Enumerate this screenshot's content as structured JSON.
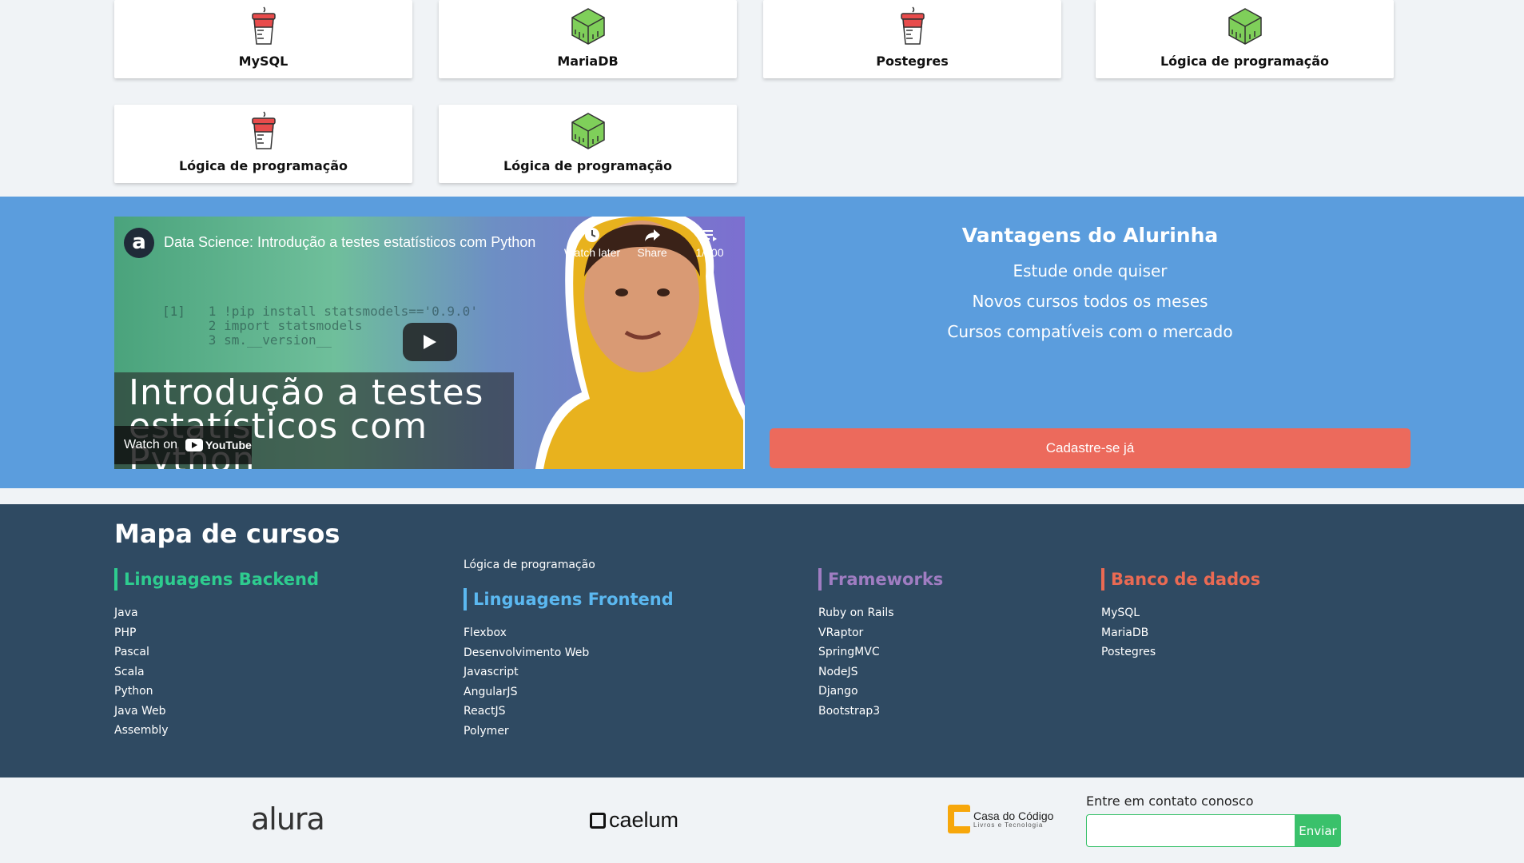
{
  "courses": [
    {
      "label": "MySQL",
      "icon": "database-cup-icon"
    },
    {
      "label": "MariaDB",
      "icon": "database-cube-icon"
    },
    {
      "label": "Postegres",
      "icon": "database-cup-icon"
    },
    {
      "label": "Lógica de programação",
      "icon": "database-cube-icon"
    },
    {
      "label": "Lógica de programação",
      "icon": "database-cup-icon"
    },
    {
      "label": "Lógica de programação",
      "icon": "database-cube-icon"
    }
  ],
  "video": {
    "channel_letter": "a",
    "title": "Data Science: Introdução a testes estatísticos com Python",
    "watch_later": "Watch later",
    "share": "Share",
    "playlist_count": "1/100",
    "overlay_title_line1": "Introdução a testes",
    "overlay_title_line2": "estatísticos com",
    "overlay_title_line3": "Python",
    "watch_on": "Watch on",
    "youtube": "YouTube",
    "code_lines": "[1]   1 !pip install statsmodels=='0.9.0'\n      2 import statsmodels\n      3 sm.__version__"
  },
  "advantages": {
    "title": "Vantagens do Alurinha",
    "items": [
      "Estude onde quiser",
      "Novos cursos todos os meses",
      "Cursos compatíveis com o mercado"
    ],
    "signup": "Cadastre-se já"
  },
  "map": {
    "title": "Mapa de cursos",
    "extra_link": "Lógica de programação",
    "columns": [
      {
        "title": "Linguagens Backend",
        "color": "#2ecc8f",
        "items": [
          "Java",
          "PHP",
          "Pascal",
          "Scala",
          "Python",
          "Java Web",
          "Assembly"
        ]
      },
      {
        "title": "Linguagens Frontend",
        "color": "#5bb8f0",
        "items": [
          "Flexbox",
          "Desenvolvimento Web",
          "Javascript",
          "AngularJS",
          "ReactJS",
          "Polymer"
        ]
      },
      {
        "title": "Frameworks",
        "color": "#a07dc2",
        "items": [
          "Ruby on Rails",
          "VRaptor",
          "SpringMVC",
          "NodeJS",
          "Django",
          "Bootstrap3"
        ]
      },
      {
        "title": "Banco de dados",
        "color": "#ea6a53",
        "items": [
          "MySQL",
          "MariaDB",
          "Postegres"
        ]
      }
    ]
  },
  "footer": {
    "alura": "alura",
    "caelum": "caelum",
    "cdc_title": "Casa do Código",
    "cdc_sub": "Livros e Tecnologia",
    "contact_label": "Entre em contato conosco",
    "contact_value": "",
    "send": "Enviar"
  }
}
